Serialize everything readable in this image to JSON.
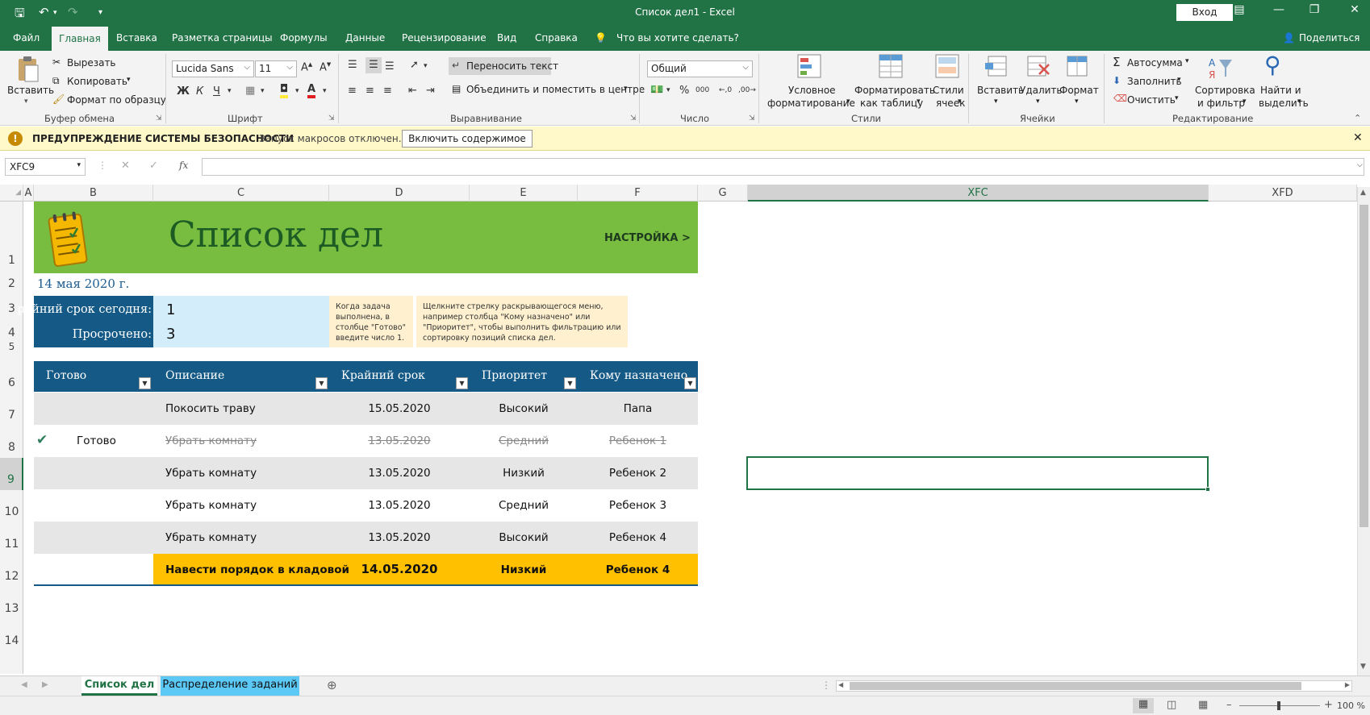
{
  "window": {
    "title": "Список дел1  -  Excel",
    "sign_in": "Вход",
    "accent": "#217346"
  },
  "ribbon_tabs": [
    "Файл",
    "Главная",
    "Вставка",
    "Разметка страницы",
    "Формулы",
    "Данные",
    "Рецензирование",
    "Вид",
    "Справка"
  ],
  "tell_me": "Что вы хотите сделать?",
  "share": "Поделиться",
  "clipboard": {
    "paste": "Вставить",
    "cut": "Вырезать",
    "copy": "Копировать",
    "format_painter": "Формат по образцу",
    "group": "Буфер обмена"
  },
  "font": {
    "name": "Lucida Sans",
    "size": "11",
    "bold": "Ж",
    "italic": "К",
    "underline": "Ч",
    "group": "Шрифт"
  },
  "alignment": {
    "wrap": "Переносить текст",
    "merge": "Объединить и поместить в центре",
    "group": "Выравнивание"
  },
  "number": {
    "format": "Общий",
    "group": "Число"
  },
  "styles": {
    "conditional": "Условное",
    "conditional2": "форматирование",
    "as_table": "Форматировать",
    "as_table2": "как таблицу",
    "cell_styles": "Стили",
    "cell_styles2": "ячеек",
    "group": "Стили"
  },
  "cells": {
    "insert": "Вставить",
    "delete": "Удалить",
    "format": "Формат",
    "group": "Ячейки"
  },
  "editing": {
    "autosum": "Автосумма",
    "fill": "Заполнить",
    "clear": "Очистить",
    "sort": "Сортировка",
    "sort2": "и фильтр",
    "find": "Найти и",
    "find2": "выделить",
    "group": "Редактирование"
  },
  "security": {
    "title": "ПРЕДУПРЕЖДЕНИЕ СИСТЕМЫ БЕЗОПАСНОСТИ",
    "message": "Запуск макросов отключен.",
    "button": "Включить содержимое"
  },
  "formula_bar": {
    "name_box": "XFC9",
    "fx": "fx",
    "value": ""
  },
  "columns": [
    "A",
    "B",
    "C",
    "D",
    "E",
    "F",
    "G",
    "XFC",
    "XFD"
  ],
  "rows": [
    "1",
    "2",
    "3",
    "4",
    "5",
    "6",
    "7",
    "8",
    "9",
    "10",
    "11",
    "12",
    "13",
    "14"
  ],
  "sheet": {
    "title": "Список дел",
    "setup_link": "НАСТРОЙКА >",
    "date": "14 мая 2020 г.",
    "due_today_label": "райний срок сегодня:",
    "due_today_value": "1",
    "overdue_label": "Просрочено:",
    "overdue_value": "3",
    "note1": "Когда задача выполнена, в столбце \"Готово\" введите число 1.",
    "note2": "Щелкните стрелку раскрывающегося меню, например столбца \"Кому назначено\" или \"Приоритет\", чтобы выполнить фильтрацию или сортировку позиций списка дел.",
    "headers": [
      "Готово",
      "Описание",
      "Крайний срок",
      "Приоритет",
      "Кому назначено"
    ],
    "tasks": [
      {
        "done": "",
        "desc": "Покосить траву",
        "due": "15.05.2020",
        "priority": "Высокий",
        "assignee": "Папа"
      },
      {
        "done": "Готово",
        "desc": "Убрать комнату",
        "due": "13.05.2020",
        "priority": "Средний",
        "assignee": "Ребенок 1"
      },
      {
        "done": "",
        "desc": "Убрать комнату",
        "due": "13.05.2020",
        "priority": "Низкий",
        "assignee": "Ребенок 2"
      },
      {
        "done": "",
        "desc": "Убрать комнату",
        "due": "13.05.2020",
        "priority": "Средний",
        "assignee": "Ребенок 3"
      },
      {
        "done": "",
        "desc": "Убрать комнату",
        "due": "13.05.2020",
        "priority": "Высокий",
        "assignee": "Ребенок 4"
      },
      {
        "done": "",
        "desc": "Навести порядок в кладовой",
        "due": "14.05.2020",
        "priority": "Низкий",
        "assignee": "Ребенок  4"
      }
    ]
  },
  "sheet_tabs": [
    "Список дел",
    "Распределение заданий"
  ],
  "status": {
    "zoom": "100 %"
  }
}
